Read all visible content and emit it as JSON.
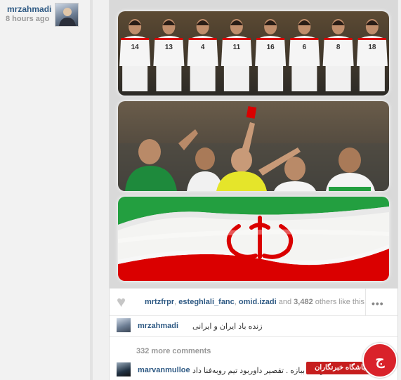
{
  "post": {
    "username": "mrzahmadi",
    "time_ago": "8 hours ago"
  },
  "likes": {
    "user1": "mrtzfrpr",
    "sep1": ", ",
    "user2": "esteghlali_fanc",
    "sep2": ", ",
    "user3": "omid.izadi",
    "and": " and ",
    "count": "3,482",
    "suffix": " others like this.",
    "more_icon": "•••"
  },
  "caption": {
    "username": "mrzahmadi",
    "text": "زنده باد ایران و ایرانی"
  },
  "comments": {
    "more_label": "332 more comments",
    "items": [
      {
        "username": "marvanmulloe",
        "text": "بود که ببازه . تقصیر داوربود تیم روبه‌فنا داد"
      }
    ]
  },
  "watermark": {
    "label": "باشگاه خبرنگاران",
    "logo_letter": "ج"
  },
  "colors": {
    "link": "#2f5a84",
    "iran_green": "#239f40",
    "iran_red": "#da0000",
    "referee_yellow": "#e5e52a"
  },
  "jersey_numbers": [
    "14",
    "13",
    "4",
    "11",
    "16",
    "6",
    "8",
    "18"
  ],
  "icons": {
    "heart": "heart-icon",
    "more": "ellipsis-icon"
  }
}
